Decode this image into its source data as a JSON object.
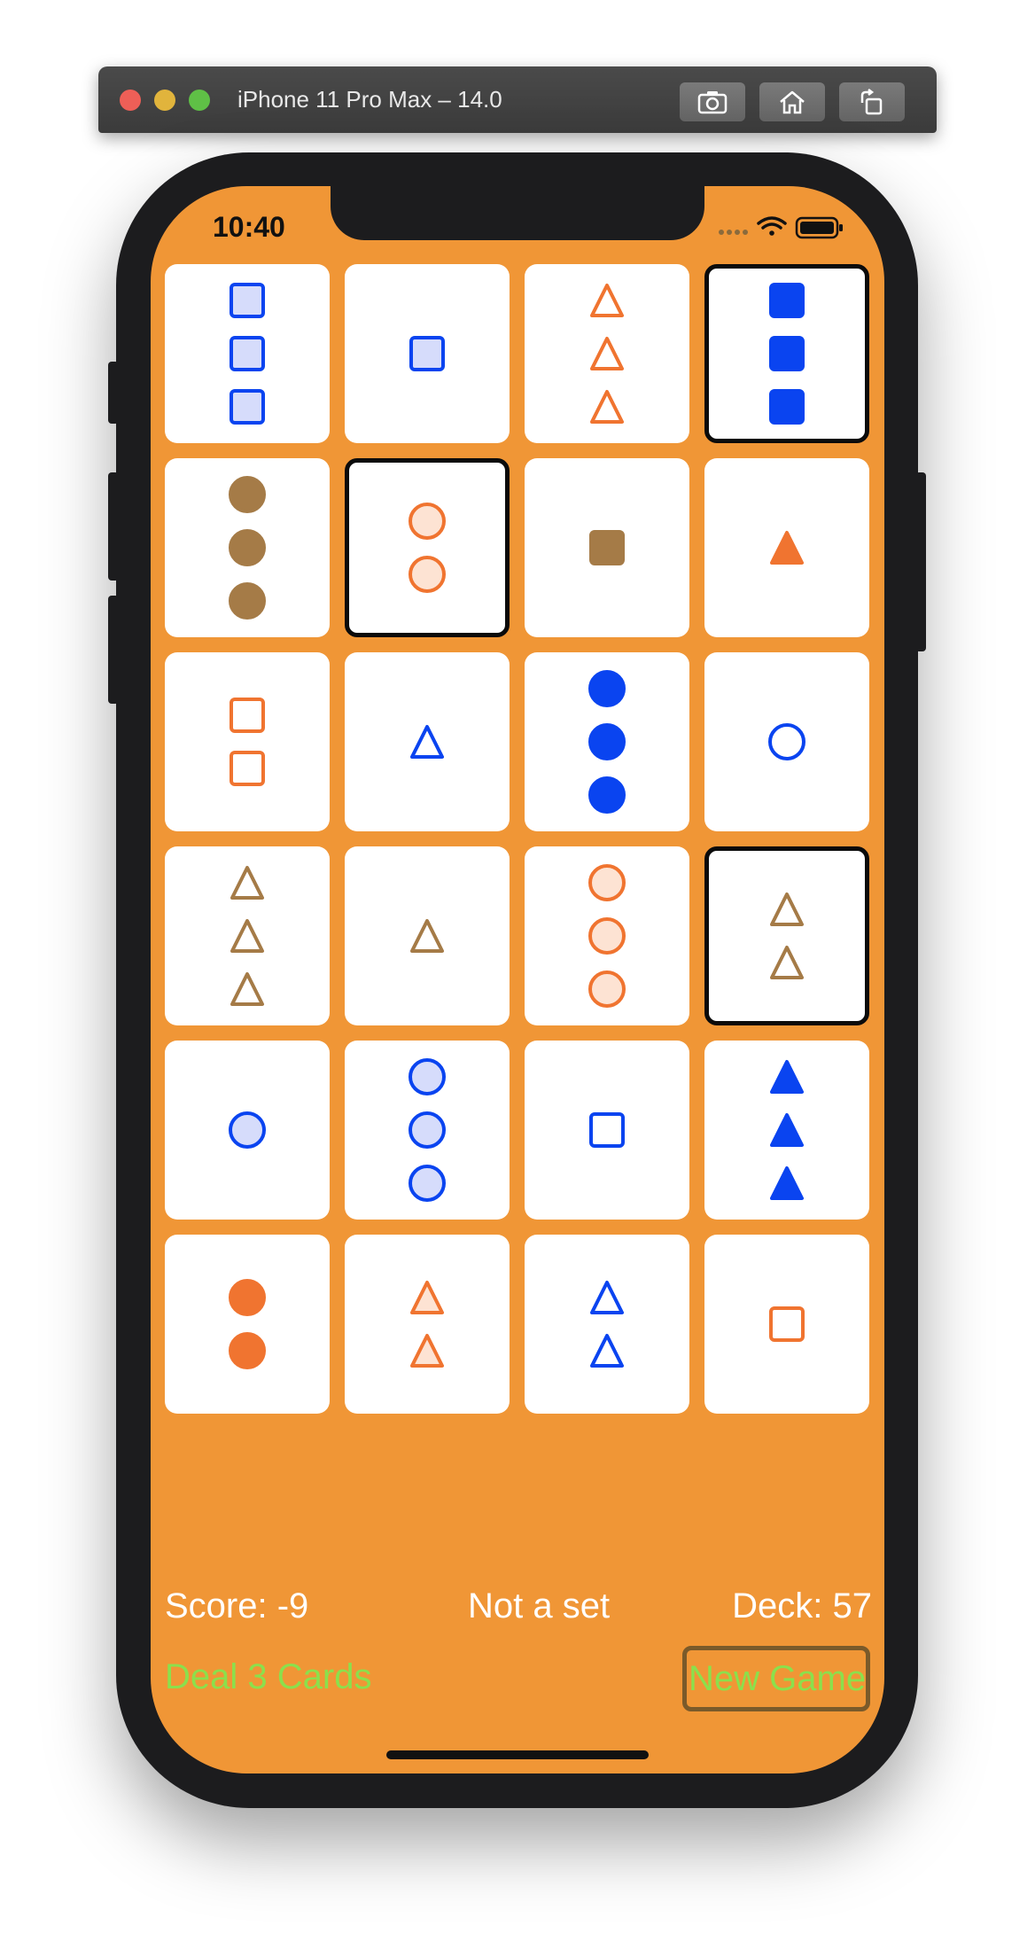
{
  "simulator": {
    "title": "iPhone 11 Pro Max – 14.0",
    "buttons": [
      {
        "name": "screenshot-icon"
      },
      {
        "name": "home-icon"
      },
      {
        "name": "rotate-icon"
      }
    ]
  },
  "status_bar": {
    "time": "10:40"
  },
  "colors": {
    "background": "#f09636",
    "blue": "#0a44f0",
    "orange": "#f07430",
    "brown": "#a57b47",
    "button_text": "#8be04c"
  },
  "cards": [
    {
      "count": 3,
      "shape": "square",
      "color": "blue",
      "fill": "striped",
      "selected": false
    },
    {
      "count": 1,
      "shape": "square",
      "color": "blue",
      "fill": "striped",
      "selected": false
    },
    {
      "count": 3,
      "shape": "triangle",
      "color": "orange",
      "fill": "open",
      "selected": false
    },
    {
      "count": 3,
      "shape": "square",
      "color": "blue",
      "fill": "solid",
      "selected": true
    },
    {
      "count": 3,
      "shape": "circle",
      "color": "brown",
      "fill": "solid",
      "selected": false
    },
    {
      "count": 2,
      "shape": "circle",
      "color": "orange",
      "fill": "striped",
      "selected": true
    },
    {
      "count": 1,
      "shape": "square",
      "color": "brown",
      "fill": "solid",
      "selected": false
    },
    {
      "count": 1,
      "shape": "triangle",
      "color": "orange",
      "fill": "solid",
      "selected": false
    },
    {
      "count": 2,
      "shape": "square",
      "color": "orange",
      "fill": "open",
      "selected": false
    },
    {
      "count": 1,
      "shape": "triangle",
      "color": "blue",
      "fill": "open",
      "selected": false
    },
    {
      "count": 3,
      "shape": "circle",
      "color": "blue",
      "fill": "solid",
      "selected": false
    },
    {
      "count": 1,
      "shape": "circle",
      "color": "blue",
      "fill": "open",
      "selected": false
    },
    {
      "count": 3,
      "shape": "triangle",
      "color": "brown",
      "fill": "open",
      "selected": false
    },
    {
      "count": 1,
      "shape": "triangle",
      "color": "brown",
      "fill": "open",
      "selected": false
    },
    {
      "count": 3,
      "shape": "circle",
      "color": "orange",
      "fill": "striped",
      "selected": false
    },
    {
      "count": 2,
      "shape": "triangle",
      "color": "brown",
      "fill": "open",
      "selected": true
    },
    {
      "count": 1,
      "shape": "circle",
      "color": "blue",
      "fill": "striped",
      "selected": false
    },
    {
      "count": 3,
      "shape": "circle",
      "color": "blue",
      "fill": "striped",
      "selected": false
    },
    {
      "count": 1,
      "shape": "square",
      "color": "blue",
      "fill": "open",
      "selected": false
    },
    {
      "count": 3,
      "shape": "triangle",
      "color": "blue",
      "fill": "solid",
      "selected": false
    },
    {
      "count": 2,
      "shape": "circle",
      "color": "orange",
      "fill": "solid",
      "selected": false
    },
    {
      "count": 2,
      "shape": "triangle",
      "color": "orange",
      "fill": "striped",
      "selected": false
    },
    {
      "count": 2,
      "shape": "triangle",
      "color": "blue",
      "fill": "open",
      "selected": false
    },
    {
      "count": 1,
      "shape": "square",
      "color": "orange",
      "fill": "open",
      "selected": false
    }
  ],
  "footer": {
    "score": "Score: -9",
    "message": "Not a set",
    "deck": "Deck: 57",
    "deal_button": "Deal 3 Cards",
    "new_game_button": "New Game"
  }
}
